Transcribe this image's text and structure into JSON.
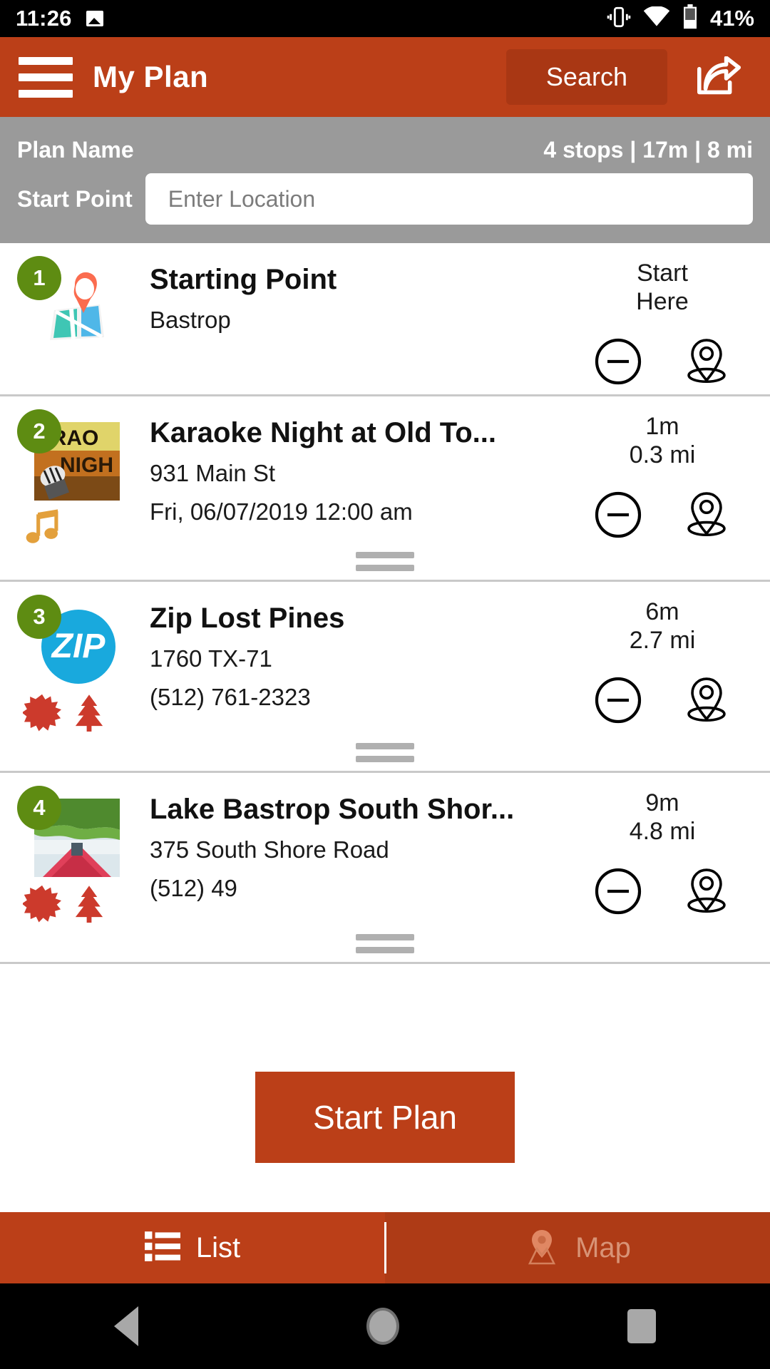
{
  "status_bar": {
    "time": "11:26",
    "battery_percent": "41%",
    "icons": [
      "image-icon",
      "vibrate-icon",
      "wifi-icon",
      "battery-icon"
    ]
  },
  "app_bar": {
    "title": "My Plan",
    "search_label": "Search",
    "menu_icon": "hamburger-menu-icon",
    "share_icon": "share-icon",
    "background_color": "#bb3f18"
  },
  "plan_info": {
    "plan_name_label": "Plan Name",
    "stats": "4 stops | 17m | 8 mi",
    "stops_count": "4 stops",
    "duration": "17m",
    "distance": "8 mi",
    "start_point_label": "Start Point",
    "start_point_value": "",
    "start_point_placeholder": "Enter Location",
    "background_color": "#9a9a9a"
  },
  "stops": [
    {
      "number": "1",
      "title": "Starting Point",
      "line1": "Bastrop",
      "line2": "",
      "eta_line1": "Start",
      "eta_line2": "Here",
      "thumb": "map-pin-thumbnail",
      "category_icons": [],
      "remove_icon": "minus-circle-icon",
      "pin_icon": "map-pin-icon",
      "has_drag_handle": false
    },
    {
      "number": "2",
      "title": "Karaoke Night at Old To...",
      "line1": "931 Main St",
      "line2": "Fri, 06/07/2019 12:00 am",
      "eta_line1": "1m",
      "eta_line2": "0.3 mi",
      "thumb": "karaoke-night-thumbnail",
      "category_icons": [
        "music-note-icon"
      ],
      "remove_icon": "minus-circle-icon",
      "pin_icon": "map-pin-icon",
      "has_drag_handle": true
    },
    {
      "number": "3",
      "title": "Zip Lost Pines",
      "line1": "1760 TX-71",
      "line2": "(512) 761-2323",
      "eta_line1": "6m",
      "eta_line2": "2.7 mi",
      "thumb": "zip-logo-thumbnail",
      "category_icons": [
        "burst-icon",
        "tree-icon"
      ],
      "remove_icon": "minus-circle-icon",
      "pin_icon": "map-pin-icon",
      "has_drag_handle": true
    },
    {
      "number": "4",
      "title": "Lake Bastrop South Shor...",
      "line1": "375 South Shore Road",
      "line2": "(512) 49",
      "eta_line1": "9m",
      "eta_line2": "4.8 mi",
      "thumb": "kayak-lake-thumbnail",
      "category_icons": [
        "burst-icon",
        "tree-icon"
      ],
      "remove_icon": "minus-circle-icon",
      "pin_icon": "map-pin-icon",
      "has_drag_handle": true
    }
  ],
  "start_plan_button": {
    "label": "Start Plan",
    "color": "#bb3f18"
  },
  "bottom_tabs": [
    {
      "label": "List",
      "icon": "list-icon",
      "active": true
    },
    {
      "label": "Map",
      "icon": "map-pin-icon",
      "active": false
    }
  ],
  "nav_bar": {
    "back_icon": "back-triangle-icon",
    "home_icon": "home-circle-icon",
    "recents_icon": "recents-square-icon"
  },
  "colors": {
    "accent": "#bb3f18",
    "badge_green": "#5e8c12",
    "info_gray": "#9a9a9a"
  }
}
